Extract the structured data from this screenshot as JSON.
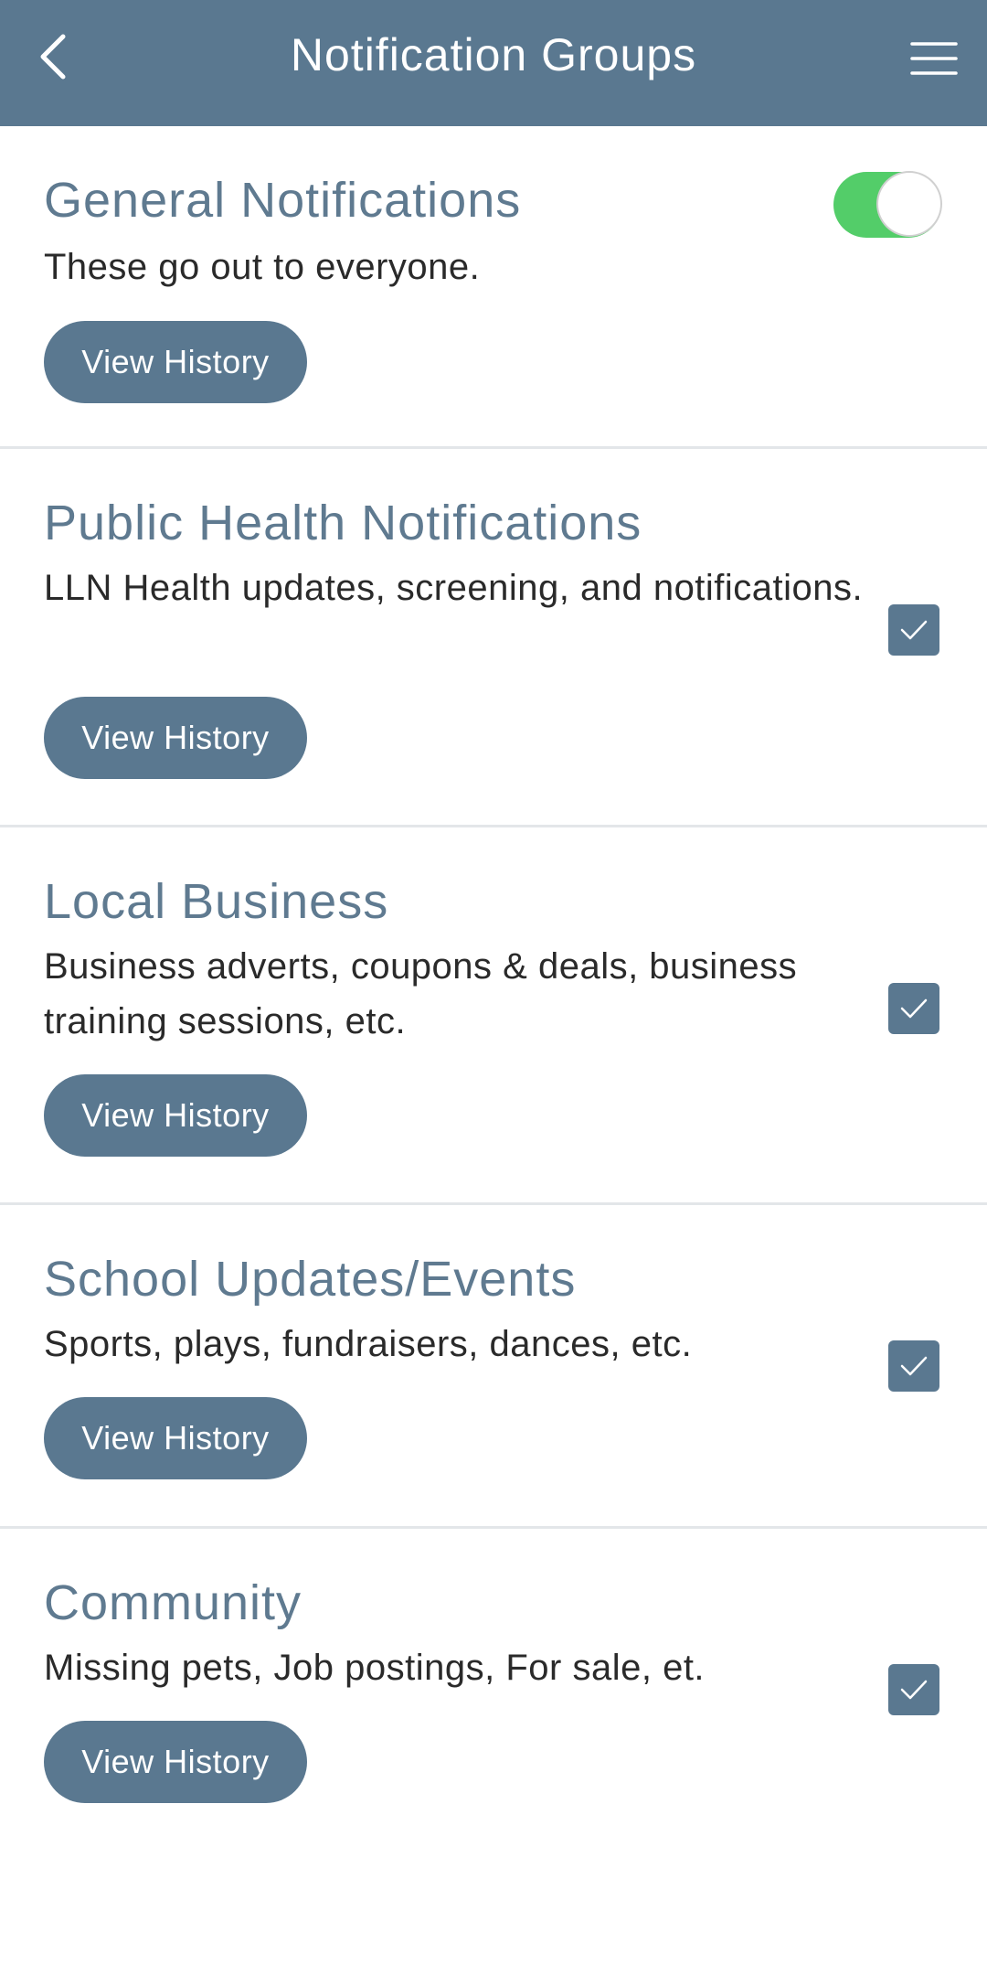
{
  "header": {
    "title": "Notification Groups",
    "back_icon": "chevron-left-icon",
    "menu_icon": "hamburger-menu-icon",
    "background_color": "#5a7890"
  },
  "groups": [
    {
      "title": "General Notifications",
      "description": "These go out to everyone.",
      "button_label": "View History",
      "control": "toggle",
      "enabled": true
    },
    {
      "title": "Public Health Notifications",
      "description": "LLN Health updates, screening, and notifications.",
      "button_label": "View History",
      "control": "checkbox",
      "checked": true
    },
    {
      "title": "Local Business",
      "description": "Business adverts, coupons & deals, business training sessions, etc.",
      "button_label": "View History",
      "control": "checkbox",
      "checked": true
    },
    {
      "title": "School Updates/Events",
      "description": "Sports, plays, fundraisers, dances, etc.",
      "button_label": "View History",
      "control": "checkbox",
      "checked": true
    },
    {
      "title": "Community",
      "description": "Missing pets, Job postings, For sale, et.",
      "button_label": "View History",
      "control": "checkbox",
      "checked": true
    }
  ],
  "colors": {
    "accent": "#5a7890",
    "title_text": "#5f7a90",
    "toggle_on": "#53cd69",
    "divider": "#e3e6e9"
  }
}
